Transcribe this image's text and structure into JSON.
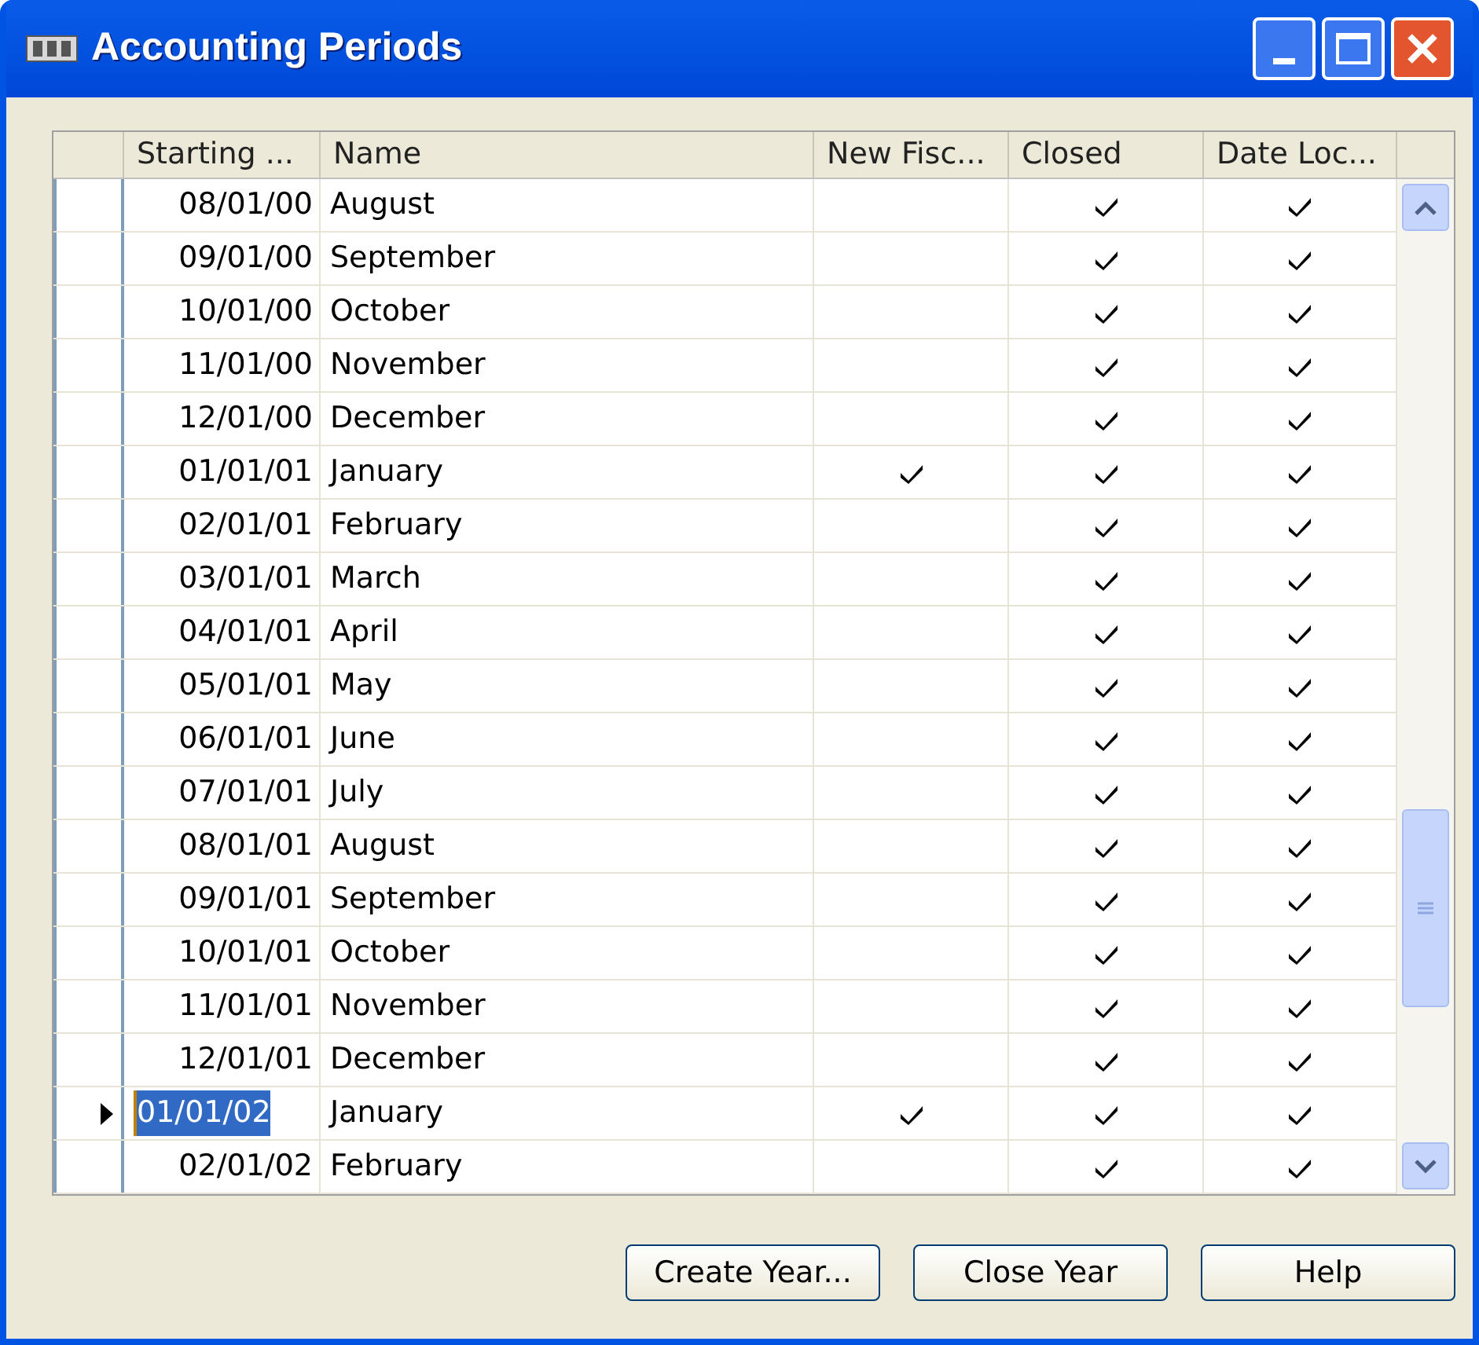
{
  "window": {
    "title": "Accounting Periods"
  },
  "table": {
    "columns": [
      "Starting ...",
      "Name",
      "New Fisc...",
      "Closed",
      "Date Loc..."
    ],
    "rows": [
      {
        "starting_date": "08/01/00",
        "name": "August",
        "new_fiscal_year": false,
        "closed": true,
        "date_locked": true,
        "selected": false
      },
      {
        "starting_date": "09/01/00",
        "name": "September",
        "new_fiscal_year": false,
        "closed": true,
        "date_locked": true,
        "selected": false
      },
      {
        "starting_date": "10/01/00",
        "name": "October",
        "new_fiscal_year": false,
        "closed": true,
        "date_locked": true,
        "selected": false
      },
      {
        "starting_date": "11/01/00",
        "name": "November",
        "new_fiscal_year": false,
        "closed": true,
        "date_locked": true,
        "selected": false
      },
      {
        "starting_date": "12/01/00",
        "name": "December",
        "new_fiscal_year": false,
        "closed": true,
        "date_locked": true,
        "selected": false
      },
      {
        "starting_date": "01/01/01",
        "name": "January",
        "new_fiscal_year": true,
        "closed": true,
        "date_locked": true,
        "selected": false
      },
      {
        "starting_date": "02/01/01",
        "name": "February",
        "new_fiscal_year": false,
        "closed": true,
        "date_locked": true,
        "selected": false
      },
      {
        "starting_date": "03/01/01",
        "name": "March",
        "new_fiscal_year": false,
        "closed": true,
        "date_locked": true,
        "selected": false
      },
      {
        "starting_date": "04/01/01",
        "name": "April",
        "new_fiscal_year": false,
        "closed": true,
        "date_locked": true,
        "selected": false
      },
      {
        "starting_date": "05/01/01",
        "name": "May",
        "new_fiscal_year": false,
        "closed": true,
        "date_locked": true,
        "selected": false
      },
      {
        "starting_date": "06/01/01",
        "name": "June",
        "new_fiscal_year": false,
        "closed": true,
        "date_locked": true,
        "selected": false
      },
      {
        "starting_date": "07/01/01",
        "name": "July",
        "new_fiscal_year": false,
        "closed": true,
        "date_locked": true,
        "selected": false
      },
      {
        "starting_date": "08/01/01",
        "name": "August",
        "new_fiscal_year": false,
        "closed": true,
        "date_locked": true,
        "selected": false
      },
      {
        "starting_date": "09/01/01",
        "name": "September",
        "new_fiscal_year": false,
        "closed": true,
        "date_locked": true,
        "selected": false
      },
      {
        "starting_date": "10/01/01",
        "name": "October",
        "new_fiscal_year": false,
        "closed": true,
        "date_locked": true,
        "selected": false
      },
      {
        "starting_date": "11/01/01",
        "name": "November",
        "new_fiscal_year": false,
        "closed": true,
        "date_locked": true,
        "selected": false
      },
      {
        "starting_date": "12/01/01",
        "name": "December",
        "new_fiscal_year": false,
        "closed": true,
        "date_locked": true,
        "selected": false
      },
      {
        "starting_date": "01/01/02",
        "name": "January",
        "new_fiscal_year": true,
        "closed": true,
        "date_locked": true,
        "selected": true
      },
      {
        "starting_date": "02/01/02",
        "name": "February",
        "new_fiscal_year": false,
        "closed": true,
        "date_locked": true,
        "selected": false
      }
    ]
  },
  "buttons": [
    "Create Year...",
    "Close Year",
    "Help"
  ]
}
